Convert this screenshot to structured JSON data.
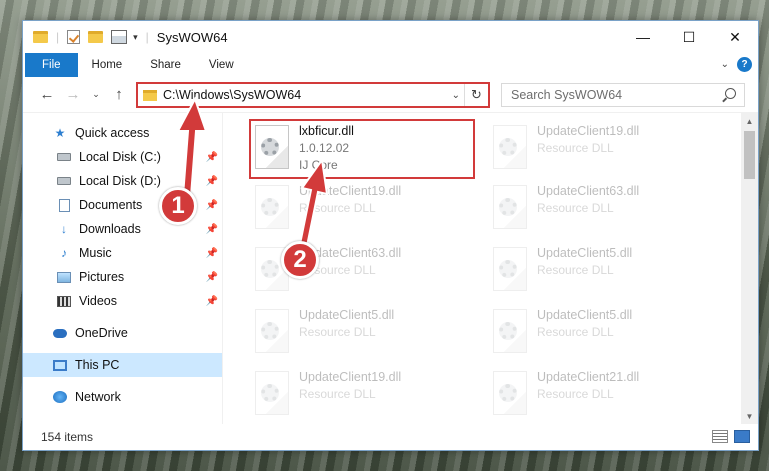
{
  "window": {
    "title": "SysWOW64"
  },
  "title_bar": {
    "quick_access_dropdown": "▾",
    "separator": "|",
    "minimize": "—",
    "maximize": "☐",
    "close": "✕"
  },
  "ribbon": {
    "tabs": [
      "File",
      "Home",
      "Share",
      "View"
    ],
    "expand": "⌄",
    "help": "?"
  },
  "nav": {
    "back": "←",
    "forward": "→",
    "recent": "⌄",
    "up": "↑",
    "address": "C:\\Windows\\SysWOW64",
    "address_dropdown": "⌄",
    "refresh": "↻",
    "search_placeholder": "Search SysWOW64"
  },
  "sidebar": {
    "items": [
      {
        "label": "Quick access",
        "icon": "quick-access-star-icon",
        "pinned": false
      },
      {
        "label": "Local Disk (C:)",
        "icon": "drive-icon",
        "pinned": true
      },
      {
        "label": "Local Disk (D:)",
        "icon": "drive-icon",
        "pinned": true
      },
      {
        "label": "Documents",
        "icon": "documents-icon",
        "pinned": true
      },
      {
        "label": "Downloads",
        "icon": "downloads-icon",
        "pinned": true
      },
      {
        "label": "Music",
        "icon": "music-icon",
        "pinned": true
      },
      {
        "label": "Pictures",
        "icon": "pictures-icon",
        "pinned": true
      },
      {
        "label": "Videos",
        "icon": "videos-icon",
        "pinned": true
      },
      {
        "label": "OneDrive",
        "icon": "onedrive-icon",
        "pinned": false
      },
      {
        "label": "This PC",
        "icon": "this-pc-icon",
        "pinned": false,
        "selected": true
      },
      {
        "label": "Network",
        "icon": "network-icon",
        "pinned": false
      }
    ],
    "pin_glyph": "📌"
  },
  "files": [
    {
      "name": "lxbficur.dll",
      "version": "1.0.12.02",
      "desc": "IJ Core",
      "highlighted": true
    },
    {
      "name": "UpdateClient19.dll",
      "desc": "Resource DLL"
    },
    {
      "name": "UpdateClient19.dll",
      "desc": "Resource DLL"
    },
    {
      "name": "UpdateClient63.dll",
      "desc": "Resource DLL"
    },
    {
      "name": "UpdateClient63.dll",
      "desc": "Resource DLL"
    },
    {
      "name": "UpdateClient5.dll",
      "desc": "Resource DLL"
    },
    {
      "name": "UpdateClient5.dll",
      "desc": "Resource DLL"
    },
    {
      "name": "UpdateClient5.dll",
      "desc": "Resource DLL"
    },
    {
      "name": "UpdateClient19.dll",
      "desc": "Resource DLL"
    },
    {
      "name": "UpdateClient21.dll",
      "desc": "Resource DLL"
    }
  ],
  "status": {
    "item_count": "154 items"
  },
  "annotations": {
    "step1": "1",
    "step2": "2",
    "color": "#d23a3a"
  }
}
